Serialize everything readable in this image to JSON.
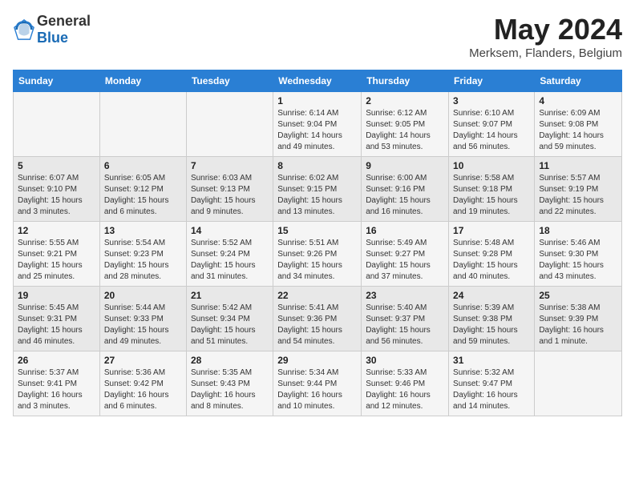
{
  "header": {
    "logo_general": "General",
    "logo_blue": "Blue",
    "month_title": "May 2024",
    "location": "Merksem, Flanders, Belgium"
  },
  "days_of_week": [
    "Sunday",
    "Monday",
    "Tuesday",
    "Wednesday",
    "Thursday",
    "Friday",
    "Saturday"
  ],
  "weeks": [
    [
      {
        "day": "",
        "info": ""
      },
      {
        "day": "",
        "info": ""
      },
      {
        "day": "",
        "info": ""
      },
      {
        "day": "1",
        "info": "Sunrise: 6:14 AM\nSunset: 9:04 PM\nDaylight: 14 hours\nand 49 minutes."
      },
      {
        "day": "2",
        "info": "Sunrise: 6:12 AM\nSunset: 9:05 PM\nDaylight: 14 hours\nand 53 minutes."
      },
      {
        "day": "3",
        "info": "Sunrise: 6:10 AM\nSunset: 9:07 PM\nDaylight: 14 hours\nand 56 minutes."
      },
      {
        "day": "4",
        "info": "Sunrise: 6:09 AM\nSunset: 9:08 PM\nDaylight: 14 hours\nand 59 minutes."
      }
    ],
    [
      {
        "day": "5",
        "info": "Sunrise: 6:07 AM\nSunset: 9:10 PM\nDaylight: 15 hours\nand 3 minutes."
      },
      {
        "day": "6",
        "info": "Sunrise: 6:05 AM\nSunset: 9:12 PM\nDaylight: 15 hours\nand 6 minutes."
      },
      {
        "day": "7",
        "info": "Sunrise: 6:03 AM\nSunset: 9:13 PM\nDaylight: 15 hours\nand 9 minutes."
      },
      {
        "day": "8",
        "info": "Sunrise: 6:02 AM\nSunset: 9:15 PM\nDaylight: 15 hours\nand 13 minutes."
      },
      {
        "day": "9",
        "info": "Sunrise: 6:00 AM\nSunset: 9:16 PM\nDaylight: 15 hours\nand 16 minutes."
      },
      {
        "day": "10",
        "info": "Sunrise: 5:58 AM\nSunset: 9:18 PM\nDaylight: 15 hours\nand 19 minutes."
      },
      {
        "day": "11",
        "info": "Sunrise: 5:57 AM\nSunset: 9:19 PM\nDaylight: 15 hours\nand 22 minutes."
      }
    ],
    [
      {
        "day": "12",
        "info": "Sunrise: 5:55 AM\nSunset: 9:21 PM\nDaylight: 15 hours\nand 25 minutes."
      },
      {
        "day": "13",
        "info": "Sunrise: 5:54 AM\nSunset: 9:23 PM\nDaylight: 15 hours\nand 28 minutes."
      },
      {
        "day": "14",
        "info": "Sunrise: 5:52 AM\nSunset: 9:24 PM\nDaylight: 15 hours\nand 31 minutes."
      },
      {
        "day": "15",
        "info": "Sunrise: 5:51 AM\nSunset: 9:26 PM\nDaylight: 15 hours\nand 34 minutes."
      },
      {
        "day": "16",
        "info": "Sunrise: 5:49 AM\nSunset: 9:27 PM\nDaylight: 15 hours\nand 37 minutes."
      },
      {
        "day": "17",
        "info": "Sunrise: 5:48 AM\nSunset: 9:28 PM\nDaylight: 15 hours\nand 40 minutes."
      },
      {
        "day": "18",
        "info": "Sunrise: 5:46 AM\nSunset: 9:30 PM\nDaylight: 15 hours\nand 43 minutes."
      }
    ],
    [
      {
        "day": "19",
        "info": "Sunrise: 5:45 AM\nSunset: 9:31 PM\nDaylight: 15 hours\nand 46 minutes."
      },
      {
        "day": "20",
        "info": "Sunrise: 5:44 AM\nSunset: 9:33 PM\nDaylight: 15 hours\nand 49 minutes."
      },
      {
        "day": "21",
        "info": "Sunrise: 5:42 AM\nSunset: 9:34 PM\nDaylight: 15 hours\nand 51 minutes."
      },
      {
        "day": "22",
        "info": "Sunrise: 5:41 AM\nSunset: 9:36 PM\nDaylight: 15 hours\nand 54 minutes."
      },
      {
        "day": "23",
        "info": "Sunrise: 5:40 AM\nSunset: 9:37 PM\nDaylight: 15 hours\nand 56 minutes."
      },
      {
        "day": "24",
        "info": "Sunrise: 5:39 AM\nSunset: 9:38 PM\nDaylight: 15 hours\nand 59 minutes."
      },
      {
        "day": "25",
        "info": "Sunrise: 5:38 AM\nSunset: 9:39 PM\nDaylight: 16 hours\nand 1 minute."
      }
    ],
    [
      {
        "day": "26",
        "info": "Sunrise: 5:37 AM\nSunset: 9:41 PM\nDaylight: 16 hours\nand 3 minutes."
      },
      {
        "day": "27",
        "info": "Sunrise: 5:36 AM\nSunset: 9:42 PM\nDaylight: 16 hours\nand 6 minutes."
      },
      {
        "day": "28",
        "info": "Sunrise: 5:35 AM\nSunset: 9:43 PM\nDaylight: 16 hours\nand 8 minutes."
      },
      {
        "day": "29",
        "info": "Sunrise: 5:34 AM\nSunset: 9:44 PM\nDaylight: 16 hours\nand 10 minutes."
      },
      {
        "day": "30",
        "info": "Sunrise: 5:33 AM\nSunset: 9:46 PM\nDaylight: 16 hours\nand 12 minutes."
      },
      {
        "day": "31",
        "info": "Sunrise: 5:32 AM\nSunset: 9:47 PM\nDaylight: 16 hours\nand 14 minutes."
      },
      {
        "day": "",
        "info": ""
      }
    ]
  ]
}
